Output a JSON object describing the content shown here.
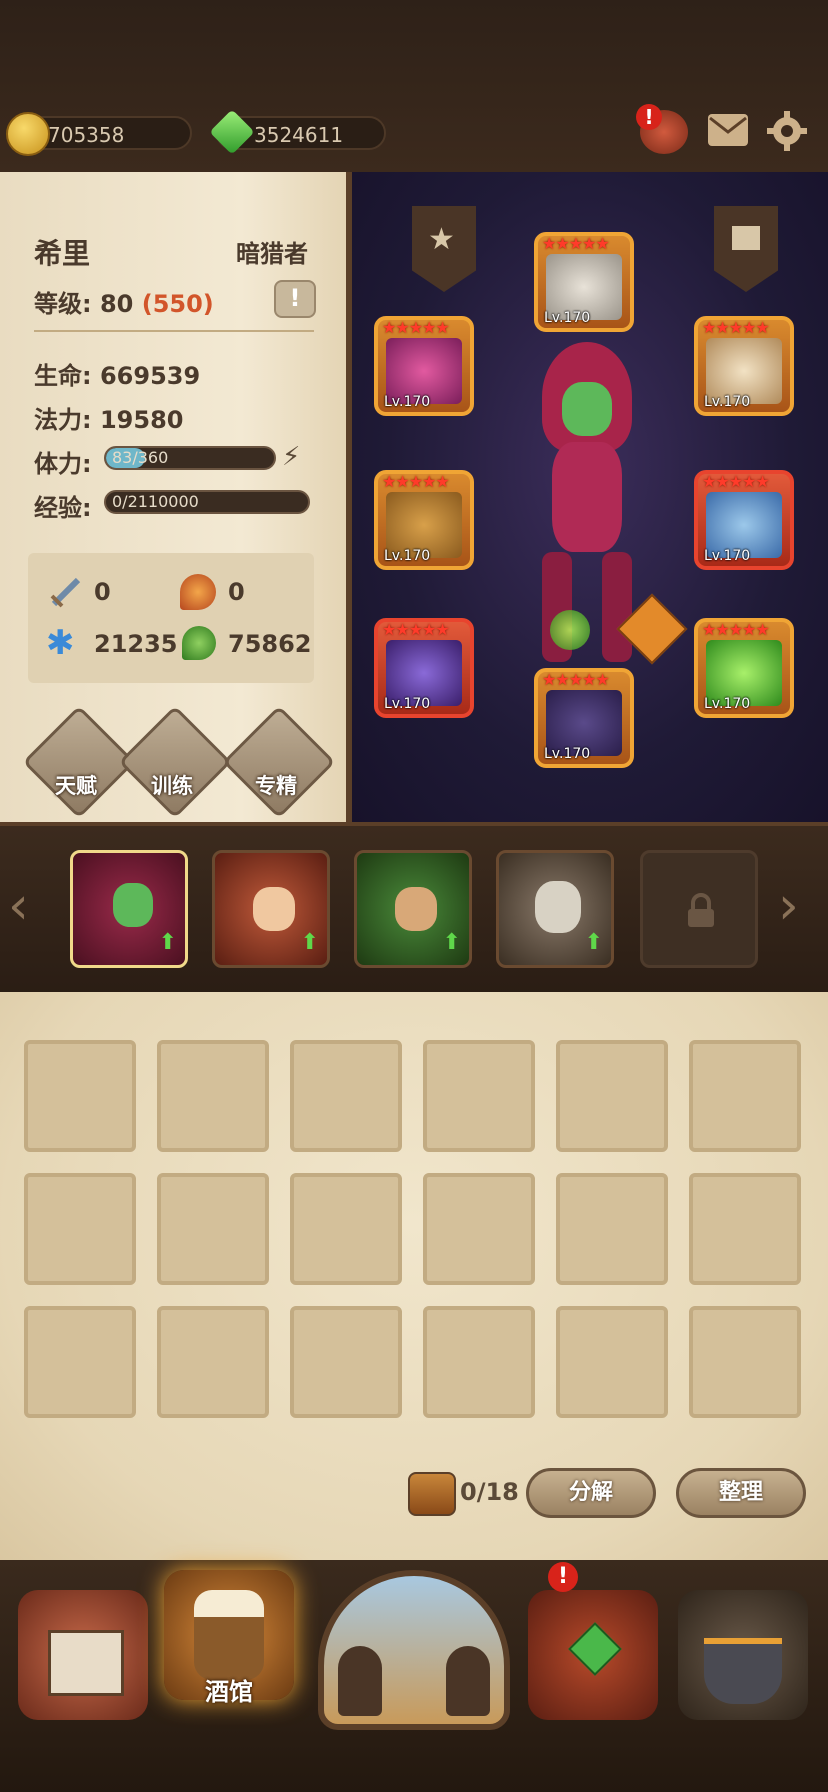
{
  "resources": {
    "gold": "705358",
    "gems": "3524611"
  },
  "hero": {
    "name": "希里",
    "class": "暗猎者",
    "level_label": "等级:",
    "level": "80",
    "level_cap": "(550)",
    "hp_label": "生命:",
    "hp": "669539",
    "mp_label": "法力:",
    "mp": "19580",
    "stamina_label": "体力:",
    "stamina_current": "83",
    "stamina_max": "/360",
    "stamina_fraction": 0.23,
    "exp_label": "经验:",
    "exp": "0/2110000",
    "stats": {
      "attack": "0",
      "fire": "0",
      "frost": "21235",
      "nature": "75862"
    }
  },
  "skill_buttons": [
    "天赋",
    "训练",
    "专精"
  ],
  "equipment": [
    {
      "slot": "helmet",
      "level": "Lv.170"
    },
    {
      "slot": "weapon-offhand",
      "level": "Lv.170"
    },
    {
      "slot": "shoulders",
      "level": "Lv.170"
    },
    {
      "slot": "gloves",
      "level": "Lv.170"
    },
    {
      "slot": "chest",
      "level": "Lv.170"
    },
    {
      "slot": "staff",
      "level": "Lv.170"
    },
    {
      "slot": "ring",
      "level": "Lv.170"
    },
    {
      "slot": "boots",
      "level": "Lv.170"
    }
  ],
  "bag": {
    "count": "0/18",
    "decompose_label": "分解",
    "sort_label": "整理"
  },
  "bottom_nav": {
    "tavern_label": "酒馆"
  },
  "colors": {
    "accent_orange": "#f0a535",
    "level_cap": "#d2552a",
    "stamina_fill": "#6fb7c9"
  }
}
